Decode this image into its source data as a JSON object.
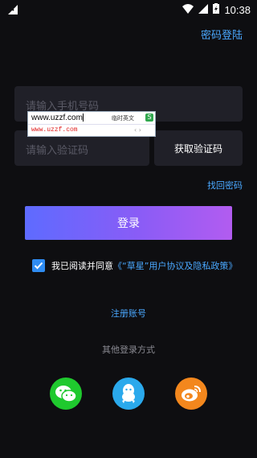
{
  "status_bar": {
    "time": "10:38",
    "icons": [
      "signal-icon",
      "wifi-icon",
      "cellular-icon",
      "battery-charging-icon"
    ]
  },
  "header": {
    "password_login_label": "密码登陆"
  },
  "form": {
    "phone_placeholder": "请输入手机号码",
    "code_placeholder": "请输入验证码",
    "get_code_label": "获取验证码",
    "forgot_password_label": "找回密码",
    "login_label": "登录"
  },
  "ime_popup": {
    "input_text": "www.uzzf.com",
    "mode_label": "临时英文",
    "candidate": "www.uzzf.com",
    "logo_letter": "S"
  },
  "agreement": {
    "checked": true,
    "prefix_text": "我已阅读并同意",
    "link_text": "《“草星”用户协议及隐私政策》"
  },
  "footer": {
    "register_label": "注册账号",
    "other_login_label": "其他登录方式",
    "social": [
      {
        "name": "wechat",
        "icon": "wechat-icon",
        "color": "#1fc92e"
      },
      {
        "name": "qq",
        "icon": "qq-icon",
        "color": "#2aa9ec"
      },
      {
        "name": "weibo",
        "icon": "weibo-icon",
        "color": "#f3871d"
      }
    ]
  },
  "colors": {
    "background": "#0e0e11",
    "accent_link": "#4aa8ff",
    "input_bg": "#202028",
    "button_gradient_start": "#5e6bff",
    "button_gradient_end": "#b25cf0"
  }
}
